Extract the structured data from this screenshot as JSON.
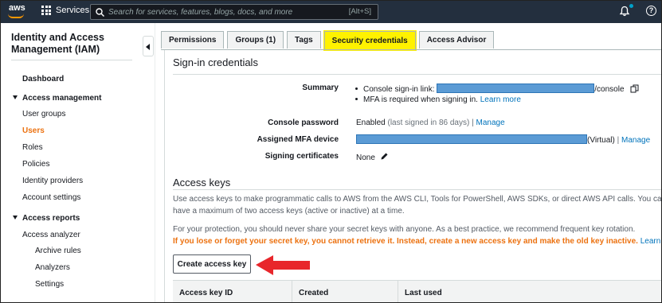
{
  "topnav": {
    "logo": "aws",
    "services_label": "Services",
    "search_placeholder": "Search for services, features, blogs, docs, and more",
    "search_shortcut": "[Alt+S]",
    "icons": [
      "services-grid-icon",
      "search-icon",
      "bell-icon",
      "help-icon"
    ]
  },
  "sidebar": {
    "title": "Identity and Access Management (IAM)",
    "dashboard": "Dashboard",
    "access_management": "Access management",
    "user_groups": "User groups",
    "users": "Users",
    "roles": "Roles",
    "policies": "Policies",
    "identity_providers": "Identity providers",
    "account_settings": "Account settings",
    "access_reports": "Access reports",
    "access_analyzer": "Access analyzer",
    "archive_rules": "Archive rules",
    "analyzers": "Analyzers",
    "settings": "Settings"
  },
  "tabs": [
    {
      "label": "Permissions"
    },
    {
      "label": "Groups (1)"
    },
    {
      "label": "Tags"
    },
    {
      "label": "Security credentials"
    },
    {
      "label": "Access Advisor"
    }
  ],
  "signin": {
    "heading": "Sign-in credentials",
    "summary_label": "Summary",
    "console_link_prefix": "Console sign-in link:",
    "console_link_suffix": "/console",
    "mfa_text": "MFA is required when signing in.",
    "learn_more": "Learn more",
    "console_password_label": "Console password",
    "console_password_value": "Enabled",
    "console_password_note": "(last signed in 86 days)",
    "separator": "|",
    "manage": "Manage",
    "mfa_device_label": "Assigned MFA device",
    "mfa_device_suffix": "(Virtual)",
    "signing_certs_label": "Signing certificates",
    "signing_certs_value": "None"
  },
  "access_keys": {
    "heading": "Access keys",
    "intro": "Use access keys to make programmatic calls to AWS from the AWS CLI, Tools for PowerShell, AWS SDKs, or direct AWS API calls. You can have a maximum of two access keys (active or inactive) at a time.",
    "protection": "For your protection, you should never share your secret keys with anyone. As a best practice, we recommend frequent key rotation.",
    "warning": "If you lose or forget your secret key, you cannot retrieve it. Instead, create a new access key and make the old key inactive.",
    "learn_more": "Learn more",
    "create_button": "Create access key",
    "columns": [
      "Access key ID",
      "Created",
      "Last used"
    ]
  },
  "colors": {
    "nav_bg": "#232f3e",
    "accent_orange": "#ec7211",
    "link_blue": "#0073bb",
    "highlight_yellow": "#fff200",
    "arrow_red": "#e8262b",
    "redaction_blue": "#5b9bd5"
  }
}
